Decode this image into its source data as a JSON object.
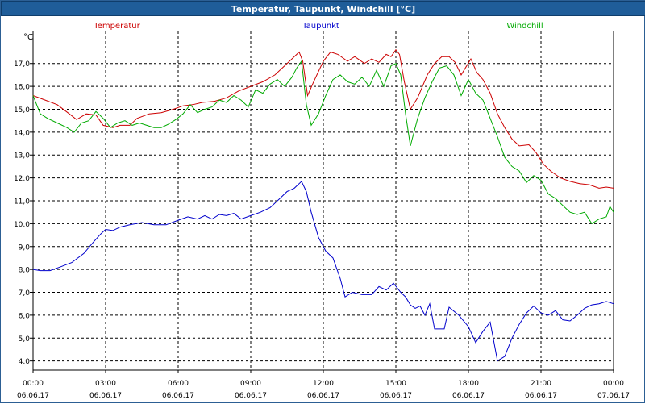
{
  "window": {
    "title": "Temperatur, Taupunkt, Windchill [°C]"
  },
  "chart_data": {
    "type": "line",
    "title": "Temperatur, Taupunkt, Windchill [°C]",
    "ylabel": "°C",
    "ylim": [
      3.6,
      18.4
    ],
    "y_ticks": [
      "4,0",
      "5,0",
      "6,0",
      "7,0",
      "8,0",
      "9,0",
      "10,0",
      "11,0",
      "12,0",
      "13,0",
      "14,0",
      "15,0",
      "16,0",
      "17,0"
    ],
    "x_ticks": [
      {
        "time": "00:00",
        "date": "06.06.17"
      },
      {
        "time": "03:00",
        "date": "06.06.17"
      },
      {
        "time": "06:00",
        "date": "06.06.17"
      },
      {
        "time": "09:00",
        "date": "06.06.17"
      },
      {
        "time": "12:00",
        "date": "06.06.17"
      },
      {
        "time": "15:00",
        "date": "06.06.17"
      },
      {
        "time": "18:00",
        "date": "06.06.17"
      },
      {
        "time": "21:00",
        "date": "06.06.17"
      },
      {
        "time": "00:00",
        "date": "07.06.17"
      }
    ],
    "x_unit": "hours from 06.06.17 00:00",
    "grid": true,
    "legend_placement": "top",
    "series": [
      {
        "name": "Temperatur",
        "color": "#cc0000",
        "points": [
          [
            0,
            15.6
          ],
          [
            0.5,
            15.4
          ],
          [
            1,
            15.2
          ],
          [
            1.5,
            14.8
          ],
          [
            1.8,
            14.55
          ],
          [
            2.2,
            14.8
          ],
          [
            2.6,
            14.75
          ],
          [
            2.9,
            14.3
          ],
          [
            3.3,
            14.2
          ],
          [
            3.6,
            14.3
          ],
          [
            4,
            14.3
          ],
          [
            4.3,
            14.6
          ],
          [
            4.8,
            14.8
          ],
          [
            5.3,
            14.85
          ],
          [
            5.8,
            15.0
          ],
          [
            6.2,
            15.15
          ],
          [
            6.6,
            15.2
          ],
          [
            7,
            15.3
          ],
          [
            7.5,
            15.35
          ],
          [
            8,
            15.5
          ],
          [
            8.5,
            15.8
          ],
          [
            9,
            16.0
          ],
          [
            9.5,
            16.2
          ],
          [
            10,
            16.5
          ],
          [
            10.4,
            16.9
          ],
          [
            10.7,
            17.2
          ],
          [
            11,
            17.5
          ],
          [
            11.15,
            17.1
          ],
          [
            11.35,
            15.6
          ],
          [
            11.6,
            16.2
          ],
          [
            12,
            17.1
          ],
          [
            12.3,
            17.5
          ],
          [
            12.6,
            17.4
          ],
          [
            13,
            17.1
          ],
          [
            13.3,
            17.3
          ],
          [
            13.7,
            17.0
          ],
          [
            14,
            17.2
          ],
          [
            14.3,
            17.05
          ],
          [
            14.6,
            17.4
          ],
          [
            14.8,
            17.3
          ],
          [
            15,
            17.6
          ],
          [
            15.15,
            17.4
          ],
          [
            15.35,
            16.2
          ],
          [
            15.6,
            15.0
          ],
          [
            15.9,
            15.5
          ],
          [
            16.3,
            16.5
          ],
          [
            16.6,
            17.0
          ],
          [
            16.9,
            17.3
          ],
          [
            17.2,
            17.3
          ],
          [
            17.45,
            17.05
          ],
          [
            17.7,
            16.5
          ],
          [
            18.1,
            17.2
          ],
          [
            18.35,
            16.6
          ],
          [
            18.6,
            16.3
          ],
          [
            18.9,
            15.7
          ],
          [
            19.2,
            14.8
          ],
          [
            19.5,
            14.2
          ],
          [
            19.8,
            13.7
          ],
          [
            20.1,
            13.4
          ],
          [
            20.5,
            13.45
          ],
          [
            20.8,
            13.1
          ],
          [
            21.1,
            12.6
          ],
          [
            21.4,
            12.3
          ],
          [
            21.8,
            12.0
          ],
          [
            22.2,
            11.85
          ],
          [
            22.6,
            11.75
          ],
          [
            23,
            11.7
          ],
          [
            23.4,
            11.55
          ],
          [
            23.7,
            11.6
          ],
          [
            24,
            11.55
          ]
        ]
      },
      {
        "name": "Taupunkt",
        "color": "#0000cc",
        "points": [
          [
            0,
            8.0
          ],
          [
            0.3,
            7.95
          ],
          [
            0.7,
            7.95
          ],
          [
            1.1,
            8.1
          ],
          [
            1.6,
            8.3
          ],
          [
            2.1,
            8.7
          ],
          [
            2.5,
            9.2
          ],
          [
            2.8,
            9.55
          ],
          [
            3,
            9.75
          ],
          [
            3.3,
            9.7
          ],
          [
            3.6,
            9.85
          ],
          [
            4,
            9.95
          ],
          [
            4.5,
            10.05
          ],
          [
            5,
            9.95
          ],
          [
            5.5,
            9.95
          ],
          [
            6,
            10.15
          ],
          [
            6.4,
            10.3
          ],
          [
            6.8,
            10.2
          ],
          [
            7.1,
            10.35
          ],
          [
            7.4,
            10.2
          ],
          [
            7.7,
            10.4
          ],
          [
            8,
            10.35
          ],
          [
            8.3,
            10.45
          ],
          [
            8.6,
            10.2
          ],
          [
            9,
            10.35
          ],
          [
            9.4,
            10.5
          ],
          [
            9.8,
            10.7
          ],
          [
            10.2,
            11.1
          ],
          [
            10.5,
            11.4
          ],
          [
            10.8,
            11.55
          ],
          [
            11.1,
            11.85
          ],
          [
            11.3,
            11.4
          ],
          [
            11.5,
            10.5
          ],
          [
            11.8,
            9.4
          ],
          [
            12.1,
            8.8
          ],
          [
            12.4,
            8.5
          ],
          [
            12.7,
            7.6
          ],
          [
            12.9,
            6.8
          ],
          [
            13.2,
            7.0
          ],
          [
            13.6,
            6.9
          ],
          [
            14,
            6.9
          ],
          [
            14.3,
            7.25
          ],
          [
            14.6,
            7.1
          ],
          [
            14.9,
            7.4
          ],
          [
            15.2,
            7.0
          ],
          [
            15.4,
            6.8
          ],
          [
            15.6,
            6.45
          ],
          [
            15.8,
            6.3
          ],
          [
            16,
            6.4
          ],
          [
            16.2,
            6.0
          ],
          [
            16.4,
            6.5
          ],
          [
            16.6,
            5.4
          ],
          [
            17,
            5.4
          ],
          [
            17.2,
            6.35
          ],
          [
            17.6,
            6.0
          ],
          [
            18,
            5.5
          ],
          [
            18.3,
            4.8
          ],
          [
            18.6,
            5.3
          ],
          [
            18.9,
            5.7
          ],
          [
            19.2,
            4.0
          ],
          [
            19.5,
            4.2
          ],
          [
            19.8,
            5.0
          ],
          [
            20.1,
            5.6
          ],
          [
            20.4,
            6.1
          ],
          [
            20.7,
            6.4
          ],
          [
            21,
            6.1
          ],
          [
            21.3,
            6.0
          ],
          [
            21.6,
            6.2
          ],
          [
            21.9,
            5.8
          ],
          [
            22.2,
            5.75
          ],
          [
            22.5,
            6.0
          ],
          [
            22.8,
            6.3
          ],
          [
            23.1,
            6.45
          ],
          [
            23.4,
            6.5
          ],
          [
            23.7,
            6.6
          ],
          [
            24,
            6.5
          ]
        ]
      },
      {
        "name": "Windchill",
        "color": "#00aa00",
        "points": [
          [
            0,
            15.6
          ],
          [
            0.3,
            14.8
          ],
          [
            0.6,
            14.6
          ],
          [
            1,
            14.4
          ],
          [
            1.4,
            14.2
          ],
          [
            1.7,
            14.0
          ],
          [
            2,
            14.4
          ],
          [
            2.3,
            14.5
          ],
          [
            2.6,
            14.9
          ],
          [
            2.9,
            14.6
          ],
          [
            3.2,
            14.2
          ],
          [
            3.5,
            14.4
          ],
          [
            3.8,
            14.5
          ],
          [
            4.1,
            14.3
          ],
          [
            4.4,
            14.4
          ],
          [
            4.7,
            14.3
          ],
          [
            5,
            14.2
          ],
          [
            5.3,
            14.2
          ],
          [
            5.6,
            14.35
          ],
          [
            5.9,
            14.55
          ],
          [
            6.2,
            14.8
          ],
          [
            6.5,
            15.2
          ],
          [
            6.8,
            14.85
          ],
          [
            7.1,
            15.0
          ],
          [
            7.4,
            15.1
          ],
          [
            7.7,
            15.4
          ],
          [
            8,
            15.3
          ],
          [
            8.3,
            15.6
          ],
          [
            8.6,
            15.4
          ],
          [
            8.9,
            15.1
          ],
          [
            9.2,
            15.85
          ],
          [
            9.5,
            15.7
          ],
          [
            9.8,
            16.1
          ],
          [
            10.1,
            16.3
          ],
          [
            10.4,
            16.0
          ],
          [
            10.7,
            16.4
          ],
          [
            10.9,
            16.8
          ],
          [
            11.1,
            17.1
          ],
          [
            11.3,
            15.2
          ],
          [
            11.5,
            14.3
          ],
          [
            11.8,
            14.8
          ],
          [
            12.1,
            15.6
          ],
          [
            12.4,
            16.3
          ],
          [
            12.7,
            16.5
          ],
          [
            13,
            16.2
          ],
          [
            13.3,
            16.1
          ],
          [
            13.6,
            16.4
          ],
          [
            13.9,
            16.0
          ],
          [
            14.2,
            16.7
          ],
          [
            14.5,
            16.0
          ],
          [
            14.8,
            16.9
          ],
          [
            15,
            17.0
          ],
          [
            15.2,
            16.5
          ],
          [
            15.4,
            14.8
          ],
          [
            15.6,
            13.4
          ],
          [
            15.9,
            14.6
          ],
          [
            16.2,
            15.5
          ],
          [
            16.5,
            16.2
          ],
          [
            16.8,
            16.8
          ],
          [
            17.1,
            16.9
          ],
          [
            17.4,
            16.5
          ],
          [
            17.7,
            15.6
          ],
          [
            18,
            16.3
          ],
          [
            18.3,
            15.7
          ],
          [
            18.6,
            15.4
          ],
          [
            18.9,
            14.6
          ],
          [
            19.2,
            13.8
          ],
          [
            19.5,
            12.9
          ],
          [
            19.8,
            12.5
          ],
          [
            20.1,
            12.3
          ],
          [
            20.4,
            11.8
          ],
          [
            20.7,
            12.1
          ],
          [
            21,
            11.9
          ],
          [
            21.3,
            11.3
          ],
          [
            21.6,
            11.1
          ],
          [
            21.9,
            10.8
          ],
          [
            22.2,
            10.5
          ],
          [
            22.5,
            10.4
          ],
          [
            22.8,
            10.5
          ],
          [
            23.1,
            10.0
          ],
          [
            23.4,
            10.2
          ],
          [
            23.7,
            10.3
          ],
          [
            23.85,
            10.75
          ],
          [
            24,
            10.5
          ]
        ]
      }
    ]
  }
}
